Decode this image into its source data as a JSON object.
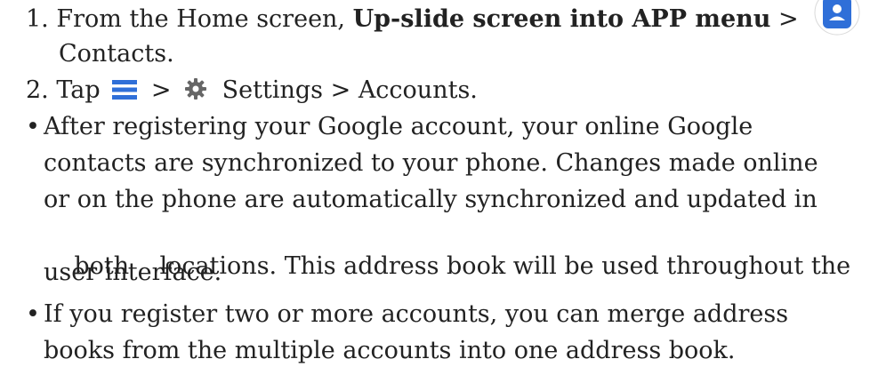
{
  "step1": {
    "number": "1.",
    "text_before": "From the Home screen,",
    "bold": "Up-slide screen into APP menu",
    "separator": ">",
    "continuation": "Contacts."
  },
  "step2": {
    "number": "2.",
    "tap": "Tap",
    "sep1": ">",
    "settings": "Settings",
    "sep2": ">",
    "accounts": "Accounts."
  },
  "bullet_symbol": "•",
  "bullet1": {
    "lines": [
      "After registering your Google account, your online Google",
      "contacts are synchronized to your phone. Changes made online",
      "or on the phone are automatically synchronized and updated in",
      "both    locations. This address book will be used throughout the",
      "user interface."
    ]
  },
  "bullet2": {
    "lines": [
      "If you register two or more accounts, you can merge address",
      "books from the multiple accounts into one address book."
    ]
  },
  "colors": {
    "text": "#222222",
    "menu_icon": "#2f6fd8",
    "gear_icon": "#666666",
    "contacts_icon_bg": "#2f6fd8"
  },
  "icons": {
    "contacts": "contacts-app-icon",
    "menu": "hamburger-menu-icon",
    "settings": "gear-icon"
  }
}
